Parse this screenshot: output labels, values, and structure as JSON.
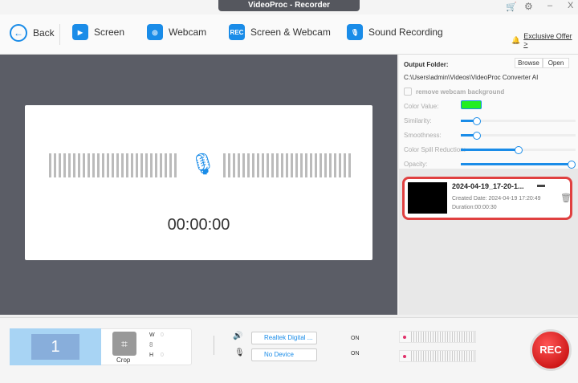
{
  "window": {
    "title": "VideoProc - Recorder",
    "minimize": "–",
    "close": "X"
  },
  "toolbar": {
    "back": "Back",
    "screen": "Screen",
    "webcam": "Webcam",
    "screen_webcam": "Screen & Webcam",
    "screen_webcam_icon": "REC",
    "sound": "Sound Recording",
    "offer": "Exclusive Offer >"
  },
  "recorder": {
    "timer": "00:00:00"
  },
  "settings": {
    "output_label": "Output Folder:",
    "browse": "Browse",
    "open": "Open",
    "path": "C:\\Users\\admin\\Videos\\VideoProc Converter AI",
    "remove_bg": "remove webcam background",
    "color_value": "Color Value:",
    "color": "#22ee22",
    "similarity": "Similarity:",
    "smoothness": "Smoothness:",
    "spill": "Color Spill Reduction:",
    "opacity": "Opacity:",
    "similarity_pct": 15,
    "smoothness_pct": 15,
    "spill_pct": 51,
    "opacity_pct": 100
  },
  "recording": {
    "name": "2024-04-19_17-20-1...",
    "created": "Created Date: 2024-04-19 17:20:49",
    "duration": "Duration:00:00:30"
  },
  "bottom": {
    "screen_num": "1",
    "crop": "Crop",
    "w_label": "W",
    "h_label": "H",
    "w": "0",
    "h": "0",
    "speaker_device": "Realtek Digital ...",
    "mic_device": "No Device",
    "on1": "ON",
    "on2": "ON",
    "rec": "REC"
  }
}
